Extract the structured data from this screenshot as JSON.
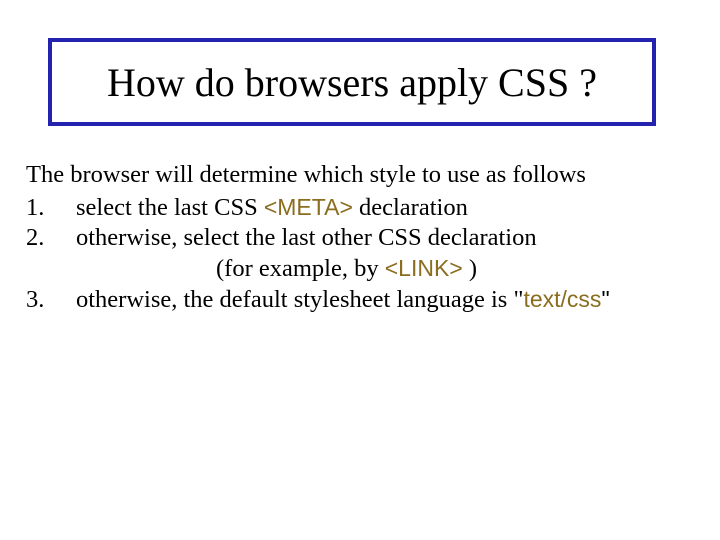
{
  "title": "How do browsers apply CSS ?",
  "intro": "The browser will determine which style to use as follows",
  "items": [
    {
      "num": "1.",
      "pre": "select the last CSS ",
      "code": "<META>",
      "post": " declaration"
    },
    {
      "num": "2.",
      "pre": "otherwise, select the last other CSS declaration",
      "sub_pre": "(for example, by ",
      "sub_code": "<LINK>",
      "sub_post": " )"
    },
    {
      "num": "3.",
      "pre": "otherwise, the default stylesheet language is \"",
      "code": "text/css",
      "post": "\""
    }
  ]
}
